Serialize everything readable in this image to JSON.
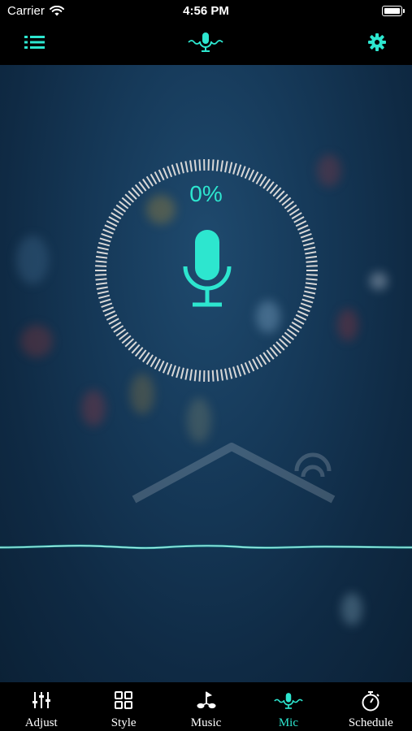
{
  "status_bar": {
    "carrier": "Carrier",
    "time": "4:56 PM"
  },
  "header": {
    "left_icon": "list-icon",
    "center_icon": "microphone-wave-icon",
    "right_icon": "gear-icon"
  },
  "main": {
    "progress_text": "0%",
    "mic_icon": "microphone-icon",
    "accent_color": "#2de6cf"
  },
  "tabs": [
    {
      "label": "Adjust",
      "icon": "sliders-icon",
      "active": false
    },
    {
      "label": "Style",
      "icon": "grid-icon",
      "active": false
    },
    {
      "label": "Music",
      "icon": "music-note-icon",
      "active": false
    },
    {
      "label": "Mic",
      "icon": "microphone-wave-icon",
      "active": true
    },
    {
      "label": "Schedule",
      "icon": "stopwatch-icon",
      "active": false
    }
  ]
}
